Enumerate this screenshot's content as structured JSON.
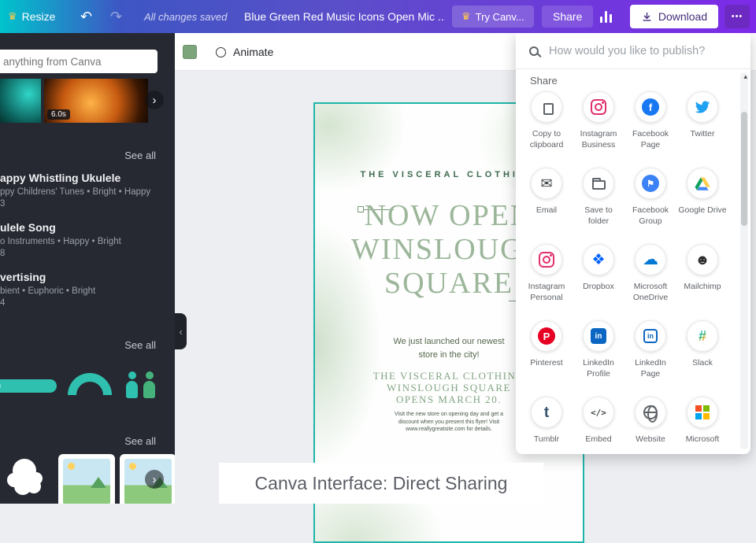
{
  "icons": {
    "crown": "♛",
    "undo": "↶",
    "redo": "↷",
    "dots": "•••",
    "chevron_right": "›",
    "chevron_left": "‹",
    "scroll_up": "▴"
  },
  "topbar": {
    "resize_label": "Resize",
    "autosave_status": "All changes saved",
    "doc_title": "Blue Green Red Music Icons Open Mic ...",
    "try_canva_label": "Try Canv...",
    "share_label": "Share",
    "download_label": "Download"
  },
  "sidebar": {
    "search_placeholder": "anything from Canva",
    "video_badge": "6.0s",
    "see_all": "See all",
    "tracks": [
      {
        "title": "appy Whistling Ukulele",
        "meta": "ppy Childrens' Tunes • Bright • Happy",
        "duration": "3"
      },
      {
        "title": "ulele Song",
        "meta": "o Instruments • Happy • Bright",
        "duration": "8"
      },
      {
        "title": "vertising",
        "meta": "bient • Euphoric • Bright",
        "duration": "4"
      }
    ]
  },
  "canvas": {
    "animate_label": "Animate",
    "flyer": {
      "brand": "THE VISCERAL CLOTHING",
      "headline1": "NOW OPEN",
      "headline2": "WINSLOUGH",
      "headline3": "SQUARE",
      "body1": "We just launched our newest",
      "body2": "store in the city!",
      "sub1": "THE VISCERAL CLOTHING",
      "sub2": "WINSLOUGH SQUARE",
      "sub3": "OPENS MARCH 20.",
      "fine1": "Visit the new store on opening day and get a",
      "fine2": "discount when you present this flyer! Visit",
      "fine3": "www.reallygreatsite.com for details."
    }
  },
  "share_panel": {
    "search_placeholder": "How would you like to publish?",
    "section_label": "Share",
    "options": [
      {
        "label": "Copy to clipboard",
        "icon": "copy-icon"
      },
      {
        "label": "Instagram Business",
        "icon": "instagram-icon"
      },
      {
        "label": "Facebook Page",
        "icon": "facebook-icon"
      },
      {
        "label": "Twitter",
        "icon": "twitter-icon"
      },
      {
        "label": "Email",
        "icon": "email-icon"
      },
      {
        "label": "Save to folder",
        "icon": "folder-icon"
      },
      {
        "label": "Facebook Group",
        "icon": "facebook-group-icon"
      },
      {
        "label": "Google Drive",
        "icon": "google-drive-icon"
      },
      {
        "label": "Instagram Personal",
        "icon": "instagram-icon"
      },
      {
        "label": "Dropbox",
        "icon": "dropbox-icon"
      },
      {
        "label": "Microsoft OneDrive",
        "icon": "onedrive-icon"
      },
      {
        "label": "Mailchimp",
        "icon": "mailchimp-icon"
      },
      {
        "label": "Pinterest",
        "icon": "pinterest-icon"
      },
      {
        "label": "LinkedIn Profile",
        "icon": "linkedin-icon"
      },
      {
        "label": "LinkedIn Page",
        "icon": "linkedin-page-icon"
      },
      {
        "label": "Slack",
        "icon": "slack-icon"
      },
      {
        "label": "Tumblr",
        "icon": "tumblr-icon"
      },
      {
        "label": "Embed",
        "icon": "embed-icon"
      },
      {
        "label": "Website",
        "icon": "website-icon"
      },
      {
        "label": "Microsoft",
        "icon": "microsoft-icon"
      }
    ]
  },
  "caption": "Canva Interface: Direct Sharing"
}
